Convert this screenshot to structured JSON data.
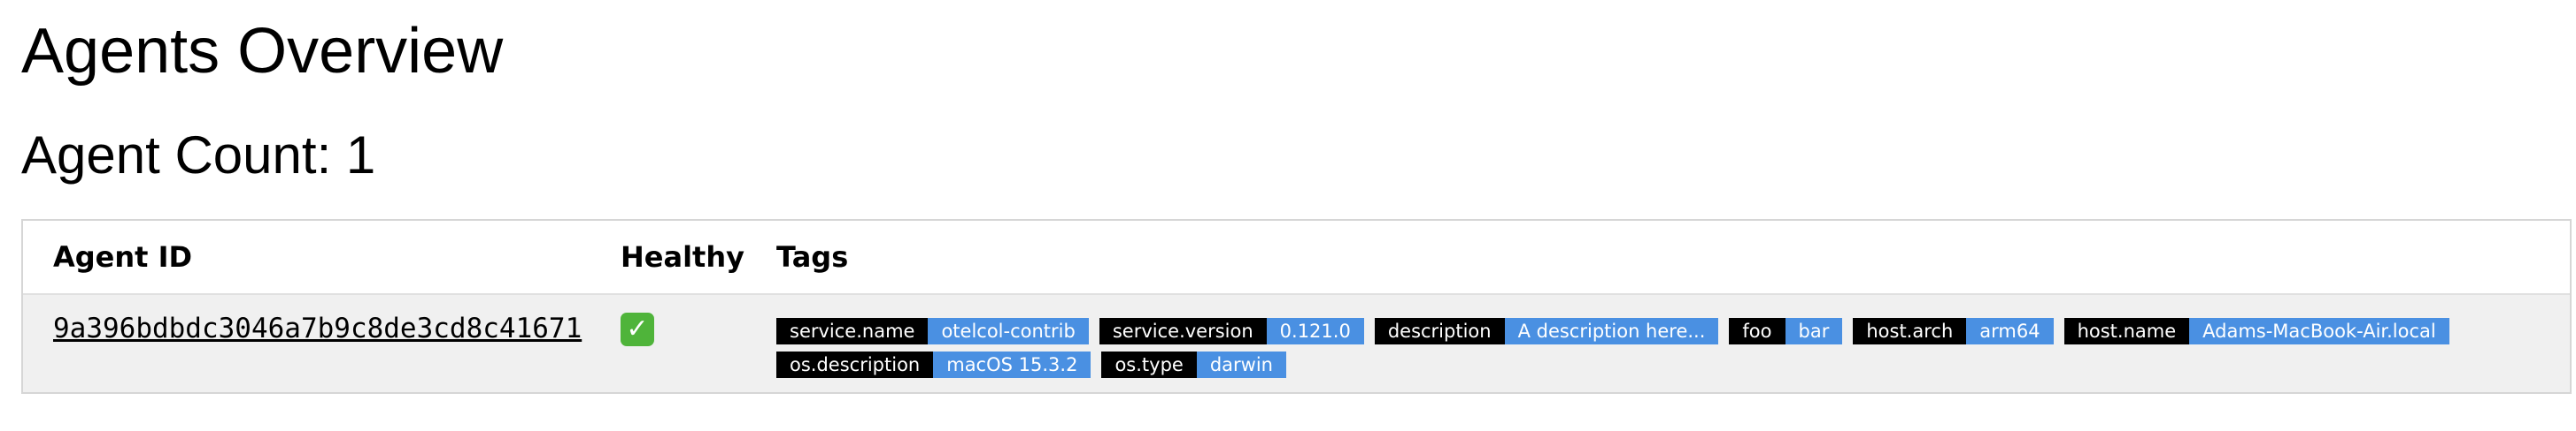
{
  "page_title": "Agents Overview",
  "agent_count_label": "Agent Count: 1",
  "table": {
    "headers": {
      "agent_id": "Agent ID",
      "healthy": "Healthy",
      "tags": "Tags"
    },
    "rows": [
      {
        "agent_id": "9a396bdbdc3046a7b9c8de3cd8c41671",
        "healthy_icon": "check-mark-icon",
        "healthy_glyph": "✓",
        "tags": [
          {
            "key": "service.name",
            "value": "otelcol-contrib"
          },
          {
            "key": "service.version",
            "value": "0.121.0"
          },
          {
            "key": "description",
            "value": "A description here..."
          },
          {
            "key": "foo",
            "value": "bar"
          },
          {
            "key": "host.arch",
            "value": "arm64"
          },
          {
            "key": "host.name",
            "value": "Adams-MacBook-Air.local"
          },
          {
            "key": "os.description",
            "value": "macOS 15.3.2"
          },
          {
            "key": "os.type",
            "value": "darwin"
          }
        ]
      }
    ]
  },
  "colors": {
    "tag_key_bg": "#000000",
    "tag_value_bg": "#4a90e2",
    "healthy_green": "#4fb43a",
    "row_bg": "#f0f0f0"
  }
}
